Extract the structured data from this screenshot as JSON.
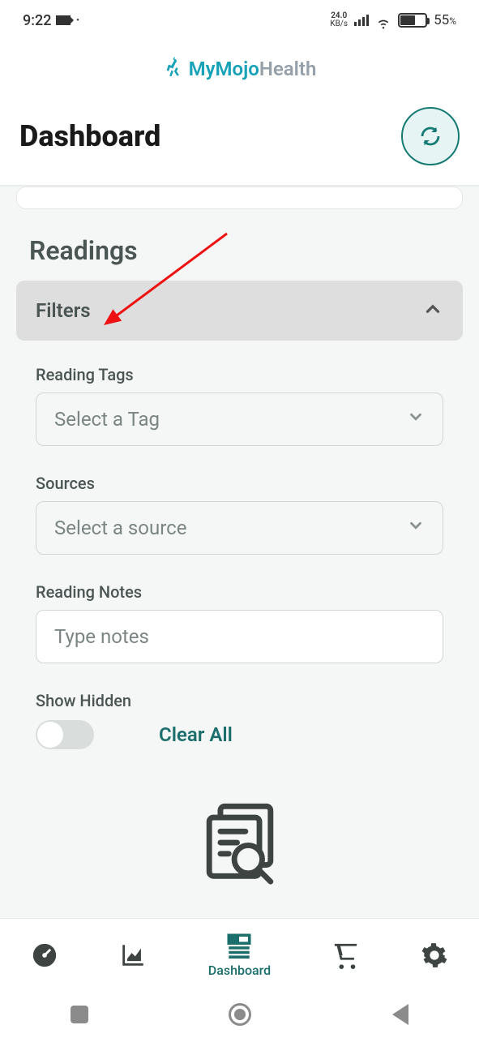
{
  "status": {
    "time": "9:22",
    "net_speed_top": "24.0",
    "net_speed_bot": "KB/s",
    "battery_pct": "55",
    "battery_pct_sym": "%"
  },
  "brand": {
    "prefix": "MyMojo",
    "suffix": "Health"
  },
  "header": {
    "title": "Dashboard"
  },
  "readings": {
    "title": "Readings",
    "filters_label": "Filters",
    "tags_label": "Reading Tags",
    "tags_placeholder": "Select a Tag",
    "sources_label": "Sources",
    "sources_placeholder": "Select a source",
    "notes_label": "Reading Notes",
    "notes_placeholder": "Type notes",
    "show_hidden_label": "Show Hidden",
    "clear_all": "Clear All"
  },
  "tabs": {
    "dashboard_label": "Dashboard"
  },
  "colors": {
    "accent": "#17a2b8",
    "teal_dark": "#157a73"
  }
}
